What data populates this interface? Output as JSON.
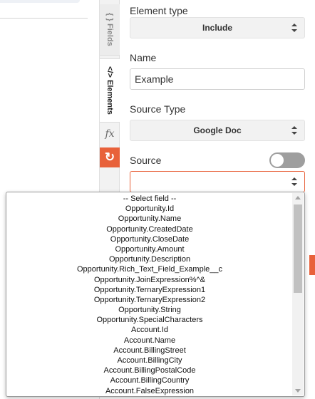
{
  "rail": {
    "fields_label": "Fields",
    "fields_icon": "{ }",
    "elements_label": "Elements",
    "elements_icon": "</>",
    "formula_icon": "fx",
    "refresh_icon": "↻"
  },
  "panel": {
    "element_type_label": "Element type",
    "element_type_value": "Include",
    "name_label": "Name",
    "name_value": "Example",
    "source_type_label": "Source Type",
    "source_type_value": "Google Doc",
    "source_label": "Source",
    "source_toggle_on": false,
    "source_value": ""
  },
  "dropdown": {
    "options": [
      "-- Select field --",
      "Opportunity.Id",
      "Opportunity.Name",
      "Opportunity.CreatedDate",
      "Opportunity.CloseDate",
      "Opportunity.Amount",
      "Opportunity.Description",
      "Opportunity.Rich_Text_Field_Example__c",
      "Opportunity.JoinExpression%^&",
      "Opportunity.TernaryExpression1",
      "Opportunity.TernaryExpression2",
      "Opportunity.String",
      "Opportunity.SpecialCharacters",
      "Account.Id",
      "Account.Name",
      "Account.BillingStreet",
      "Account.BillingCity",
      "Account.BillingPostalCode",
      "Account.BillingCountry",
      "Account.FalseExpression"
    ]
  },
  "colors": {
    "accent": "#e8613a",
    "toggle_off": "#9e9e9e",
    "select_bg": "#f2f2f2"
  }
}
